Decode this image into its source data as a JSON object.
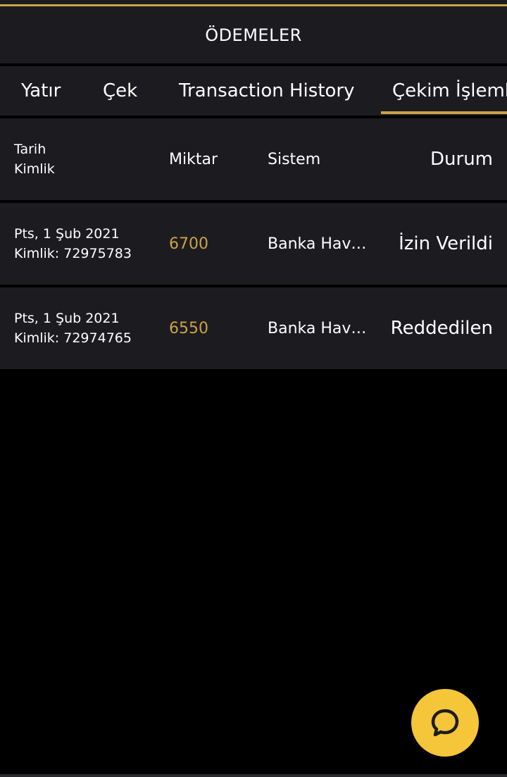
{
  "header": {
    "title": "ÖDEMELER"
  },
  "tabs": [
    {
      "label": "Yatır"
    },
    {
      "label": "Çek"
    },
    {
      "label": "Transaction History"
    },
    {
      "label": "Çekim İşlemleri",
      "active": true
    }
  ],
  "table": {
    "headers": {
      "date": "Tarih",
      "id": "Kimlik",
      "amount": "Miktar",
      "system": "Sistem",
      "status": "Durum"
    },
    "rows": [
      {
        "date": "Pts, 1 Şub 2021",
        "id": "Kimlik: 72975783",
        "amount": "6700",
        "system": "Banka Havalesi",
        "status": "İzin Verildi"
      },
      {
        "date": "Pts, 1 Şub 2021",
        "id": "Kimlik: 72974765",
        "amount": "6550",
        "system": "Banka Havalesi",
        "status": "Reddedilen"
      }
    ]
  },
  "chat": {
    "icon": "chat-bubble-icon"
  },
  "colors": {
    "accent": "#c9a24a",
    "panel": "#1c1c20",
    "chat_button": "#f5c53a"
  }
}
